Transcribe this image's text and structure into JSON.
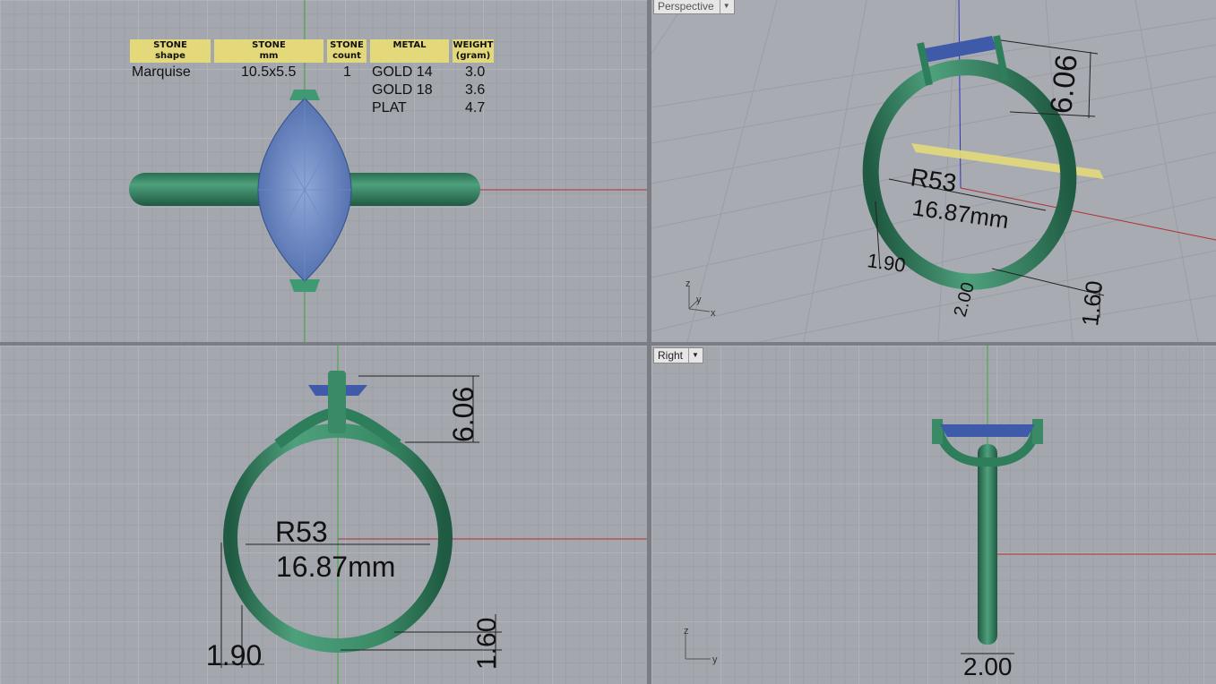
{
  "viewports": {
    "top": {
      "label": ""
    },
    "perspective": {
      "label": "Perspective"
    },
    "front": {
      "label": ""
    },
    "right": {
      "label": "Right"
    }
  },
  "spec_table": {
    "headers": [
      {
        "line1": "STONE",
        "line2": "shape"
      },
      {
        "line1": "STONE",
        "line2": "mm"
      },
      {
        "line1": "STONE",
        "line2": "count"
      },
      {
        "line1": "METAL",
        "line2": ""
      },
      {
        "line1": "WEIGHT",
        "line2": "(gram)"
      }
    ],
    "stone_shape": "Marquise",
    "stone_mm": "10.5x5.5",
    "stone_count": "1",
    "metals": [
      {
        "name": "GOLD  14",
        "weight": "3.0"
      },
      {
        "name": "GOLD  18",
        "weight": "3.6"
      },
      {
        "name": "PLAT",
        "weight": "4.7"
      }
    ]
  },
  "dimensions": {
    "size_label": "R53",
    "inner_diameter": "16.87mm",
    "height": "6.06",
    "band_thickness": "1.90",
    "shank_bottom": "1.60",
    "shank_width": "2.00"
  },
  "axis_labels": {
    "x": "x",
    "y": "y",
    "z": "z"
  },
  "colors": {
    "metal": "#2e7d5b",
    "stone": "#5b7fbf",
    "grid_bg": "#a4a8ae",
    "x_axis": "#b03030",
    "y_axis": "#30a030",
    "header_bg": "#e3d97a"
  }
}
